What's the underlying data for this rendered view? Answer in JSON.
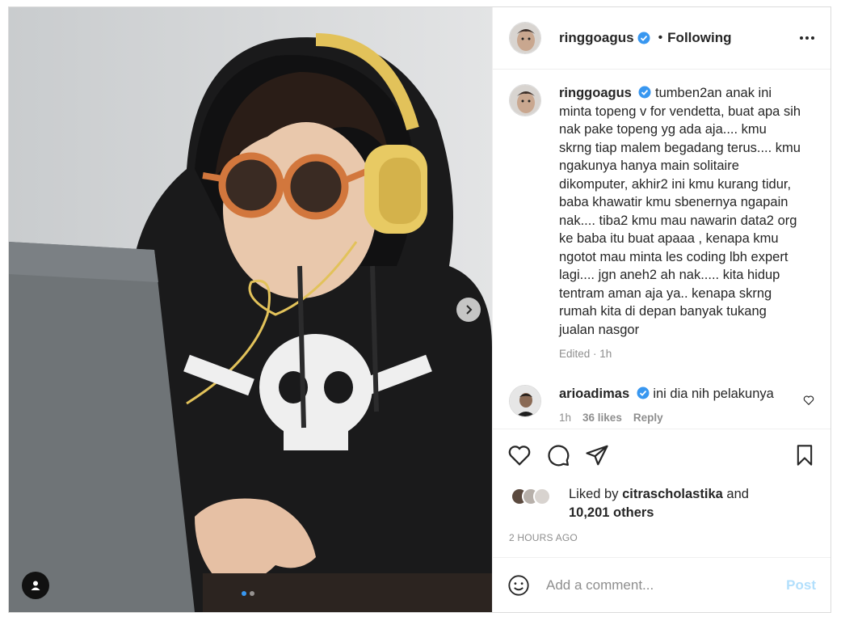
{
  "post": {
    "username": "ringgoagus",
    "follow_status": "Following",
    "bullet": "•",
    "caption": "tumben2an anak ini minta topeng v for vendetta, buat apa sih nak pake topeng yg ada aja.... kmu skrng tiap malem begadang terus.... kmu ngakunya hanya main solitaire dikomputer, akhir2 ini kmu kurang tidur, baba khawatir kmu sbenernya ngapain nak.... tiba2 kmu mau nawarin data2 org ke baba itu buat apaaa , kenapa kmu ngotot mau minta les coding lbh expert lagi.... jgn aneh2 ah nak..... kita hidup tentram aman aja ya.. kenapa skrng rumah kita di depan banyak tukang jualan nasgor",
    "caption_meta": "Edited · 1h"
  },
  "comment": {
    "username": "arioadimas",
    "text": "ini dia nih pelakunya",
    "age": "1h",
    "likes": "36 likes",
    "reply": "Reply"
  },
  "likes": {
    "prefix": "Liked by",
    "user": "citrascholastika",
    "and": "and",
    "others": "10,201 others"
  },
  "timestamp": "2 HOURS AGO",
  "composer": {
    "placeholder": "Add a comment...",
    "post_label": "Post"
  },
  "carousel": {
    "count": 2,
    "current": 1
  },
  "icons": [
    "verified-badge-icon",
    "more-options-icon",
    "heart-icon",
    "comment-icon",
    "share-icon",
    "bookmark-icon",
    "emoji-icon",
    "next-arrow-icon",
    "user-tag-icon"
  ],
  "colors": {
    "verified": "#3897f0",
    "post_button": "#b2dffc",
    "secondary_text": "#8e8e8e"
  }
}
